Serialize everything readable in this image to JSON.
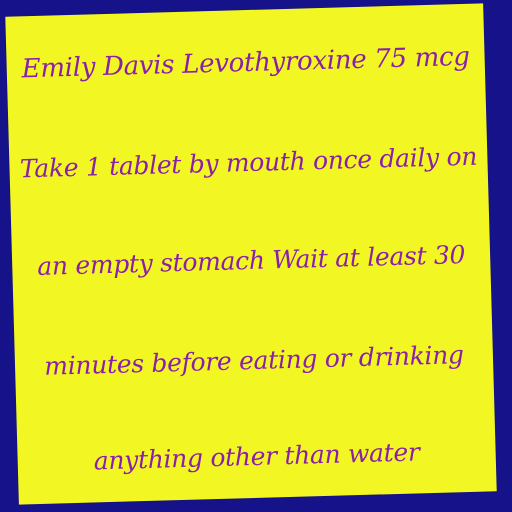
{
  "note": {
    "background_color": "#f2f723",
    "text_color": "#8a1fa8",
    "lines": [
      "Emily Davis Levothyroxine 75 mcg",
      "Take 1 tablet by mouth once daily on",
      "an empty stomach Wait at least 30",
      "minutes before eating or drinking",
      "anything other than water"
    ]
  },
  "page": {
    "background_color": "#15128a"
  }
}
